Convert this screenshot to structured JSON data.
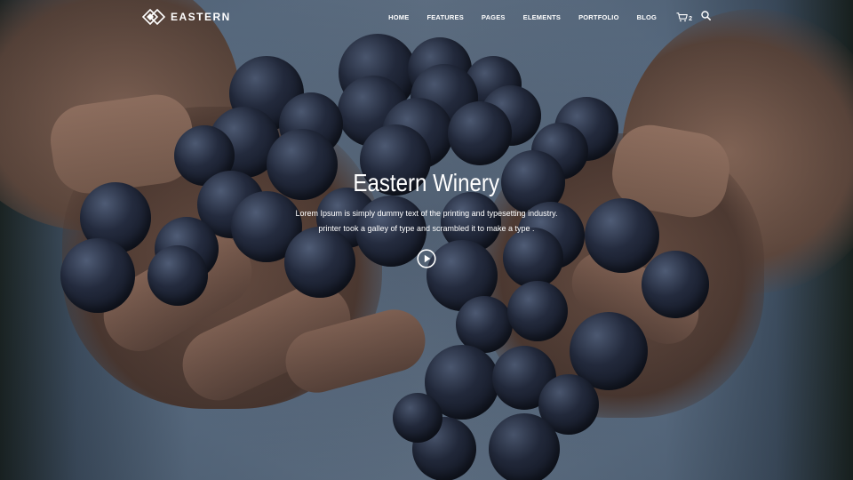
{
  "brand": {
    "name": "EASTERN",
    "logo_icon": "diamond-logo-icon"
  },
  "nav": {
    "items": [
      {
        "label": "HOME"
      },
      {
        "label": "FEATURES"
      },
      {
        "label": "PAGES"
      },
      {
        "label": "ELEMENTS"
      },
      {
        "label": "PORTFOLIO"
      },
      {
        "label": "BLOG"
      }
    ],
    "cart": {
      "icon": "cart-icon",
      "count": "2"
    },
    "search": {
      "icon": "search-icon"
    }
  },
  "hero": {
    "title": "Eastern Winery",
    "subtitle_line1": "Lorem Ipsum is simply dummy text of the printing and typesetting industry.",
    "subtitle_line2": "printer took a galley of type and scrambled it to make a type .",
    "play_icon": "play-icon"
  },
  "colors": {
    "text": "#ffffff",
    "grape": "#232a3d",
    "sleeve": "#7f95ae"
  }
}
